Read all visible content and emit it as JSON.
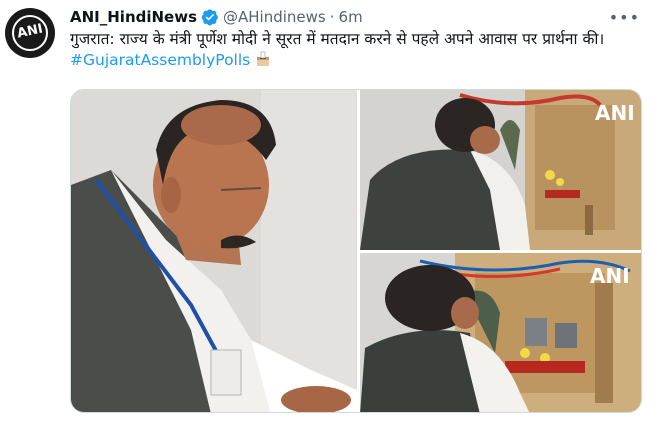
{
  "tweet": {
    "display_name": "ANI_HindiNews",
    "handle": "@AHindinews",
    "separator": "·",
    "time": "6m",
    "more_label": "•••",
    "text": "गुजरात: राज्य के मंत्री पूर्णेश मोदी ने सूरत में मतदान करने से पहले अपने आवास पर प्रार्थना की। ",
    "hashtag": "#GujaratAssemblyPolls",
    "emoji": "ballot-box-icon",
    "avatar_text": "ANI",
    "verified_color": "#1d9bf0",
    "link_color": "#1d9bf0"
  },
  "media": {
    "watermark": "ANI",
    "photos": [
      {
        "name": "minister-praying-closeup"
      },
      {
        "name": "minister-at-home-shrine"
      },
      {
        "name": "minister-at-shrine-side-view"
      }
    ]
  }
}
